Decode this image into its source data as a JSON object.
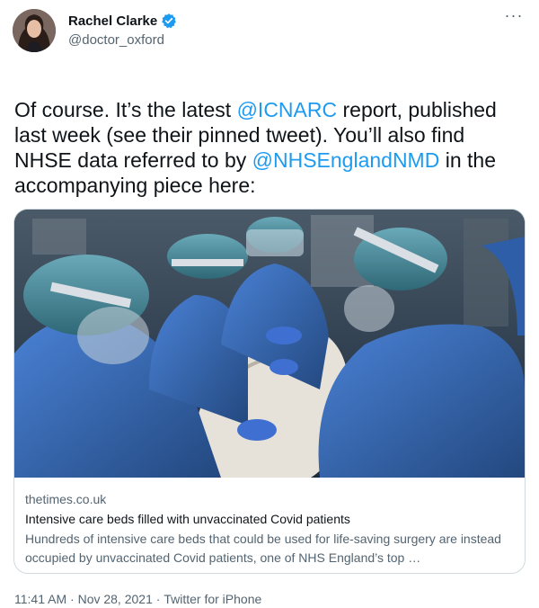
{
  "author": {
    "display_name": "Rachel Clarke",
    "handle": "@doctor_oxford",
    "verified_icon": "verified-badge-icon",
    "avatar_icon": "profile-photo"
  },
  "menu": {
    "more_icon": "more-horizontal-icon",
    "more_glyph": "···"
  },
  "tweet": {
    "segments": [
      "Of course. It’s the latest ",
      "@ICNARC",
      " report, published last week (see their pinned tweet). You’ll also find NHSE data referred to by ",
      "@NHSEnglandNMD",
      " in the accompanying piece here:"
    ]
  },
  "link_card": {
    "domain": "thetimes.co.uk",
    "title": "Intensive care beds filled with unvaccinated Covid patients",
    "description": "Hundreds of intensive care beds that could be used for life-saving surgery are instead occupied by unvaccinated Covid patients, one of NHS England’s top …",
    "image_subject": "intensive-care-staff-photo"
  },
  "meta": {
    "time": "11:41 AM",
    "separator": "·",
    "date": "Nov 28, 2021",
    "source": "Twitter for iPhone"
  },
  "colors": {
    "link": "#1d9bf0",
    "text": "#0f1419",
    "secondary": "#536471",
    "border": "#cfd9de",
    "gown_blue": "#3a6fc4"
  }
}
